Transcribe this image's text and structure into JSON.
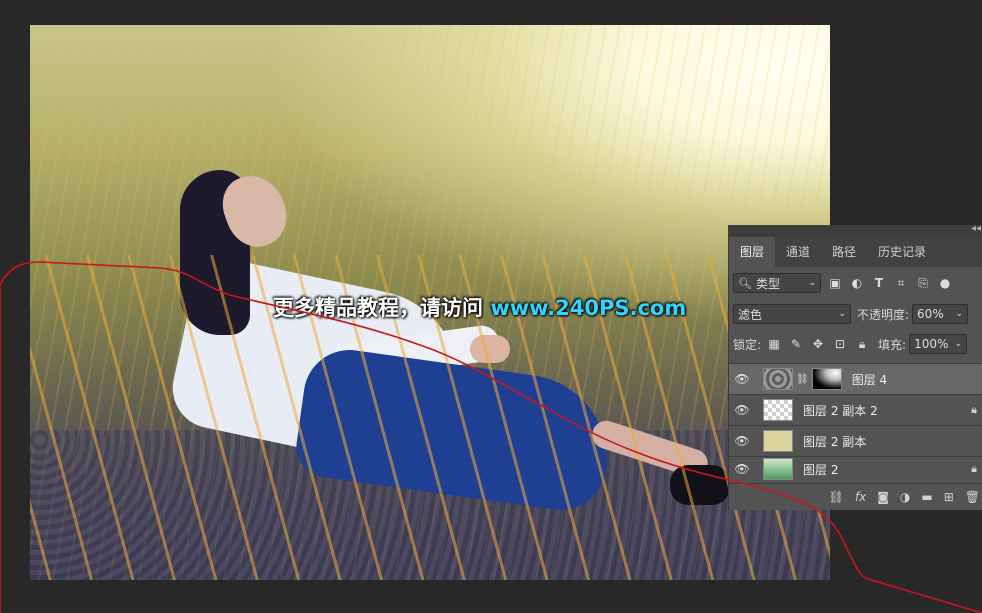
{
  "watermark": {
    "text_cn": "更多精品教程，请访问",
    "url": "www.240PS.com"
  },
  "panel": {
    "tabs": [
      "图层",
      "通道",
      "路径",
      "历史记录"
    ],
    "active_tab": "图层",
    "filter_kind": "类型",
    "blend_mode": "滤色",
    "opacity_label": "不透明度:",
    "opacity_value": "60%",
    "lock_label": "锁定:",
    "fill_label": "填充:",
    "fill_value": "100%",
    "layers": [
      {
        "name": "图层 4",
        "selected": true,
        "locked": false
      },
      {
        "name": "图层 2 副本 2",
        "selected": false,
        "locked": true
      },
      {
        "name": "图层 2 副本",
        "selected": false,
        "locked": false
      },
      {
        "name": "图层 2",
        "selected": false,
        "locked": true
      }
    ],
    "bottom_icons": [
      "link-icon",
      "fx-icon",
      "mask-icon",
      "adjustment-icon",
      "folder-icon",
      "new-layer-icon",
      "trash-icon"
    ],
    "fx_label": "fx"
  },
  "colors": {
    "workspace": "#282828",
    "panel": "#535353",
    "selected_layer": "#686868",
    "annotation_line": "#c8171b",
    "watermark_url": "#2fd4ff"
  }
}
